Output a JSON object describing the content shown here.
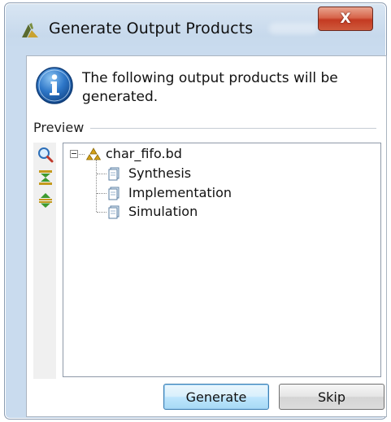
{
  "window": {
    "title": "Generate Output Products",
    "close_label": "X"
  },
  "message": "The following output products will be generated.",
  "preview": {
    "label": "Preview",
    "tree": {
      "root": "char_fifo.bd",
      "children": [
        "Synthesis",
        "Implementation",
        "Simulation"
      ]
    }
  },
  "toolbar": {
    "icons": [
      "search-icon",
      "collapse-all-icon",
      "expand-all-icon"
    ]
  },
  "buttons": {
    "generate": "Generate",
    "skip": "Skip"
  },
  "colors": {
    "title_bar": "#c9dbee",
    "close_button": "#c43a22",
    "default_button_border": "#3c7fb1"
  }
}
